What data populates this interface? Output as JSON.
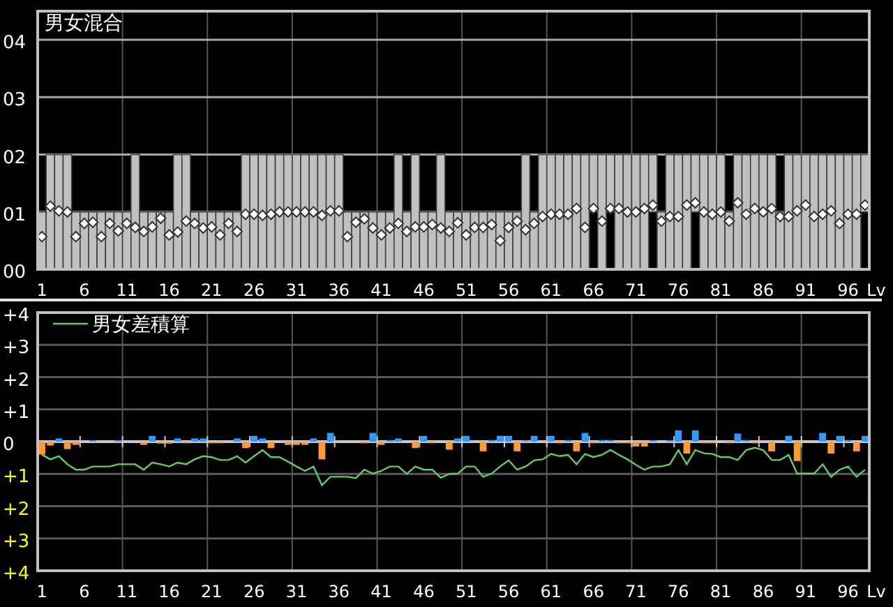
{
  "top_chart": {
    "chart_data": {
      "type": "bar",
      "stacked": true,
      "grid": true,
      "xlabel": "Lv",
      "xlim": [
        0.5,
        98.5
      ],
      "x": [
        1,
        2,
        3,
        4,
        5,
        6,
        7,
        8,
        9,
        10,
        11,
        12,
        13,
        14,
        15,
        16,
        17,
        18,
        19,
        20,
        21,
        22,
        23,
        24,
        25,
        26,
        27,
        28,
        29,
        30,
        31,
        32,
        33,
        34,
        35,
        36,
        37,
        38,
        39,
        40,
        41,
        42,
        43,
        44,
        45,
        46,
        47,
        48,
        49,
        50,
        51,
        52,
        53,
        54,
        55,
        56,
        57,
        58,
        59,
        60,
        61,
        62,
        63,
        64,
        65,
        66,
        67,
        68,
        69,
        70,
        71,
        72,
        73,
        74,
        75,
        76,
        77,
        78,
        79,
        80,
        81,
        82,
        83,
        84,
        85,
        86,
        87,
        88,
        89,
        90,
        91,
        92,
        93,
        94,
        95,
        96,
        97,
        98
      ],
      "xticks": [
        1,
        6,
        11,
        16,
        21,
        26,
        31,
        36,
        41,
        46,
        51,
        56,
        61,
        66,
        71,
        76,
        81,
        86,
        91,
        96
      ],
      "ylim": [
        0,
        4.5
      ],
      "yticks": [
        {
          "value": 0,
          "label": "00"
        },
        {
          "value": 1,
          "label": "01"
        },
        {
          "value": 2,
          "label": "02"
        },
        {
          "value": 3,
          "label": "03"
        },
        {
          "value": 4,
          "label": "04"
        }
      ],
      "series": [
        {
          "color": "#000000",
          "values": [
            0,
            0,
            0,
            0,
            0,
            0,
            0,
            0,
            0,
            0,
            0,
            0,
            0,
            0,
            0,
            0,
            0,
            0,
            0,
            0,
            0,
            0,
            0,
            0,
            0,
            0,
            0,
            0,
            0,
            0,
            0,
            0,
            0,
            0,
            0,
            0,
            0,
            0,
            0,
            0,
            0,
            0,
            0,
            0,
            0,
            0,
            0,
            0,
            0,
            0,
            0,
            0,
            0,
            0,
            0,
            0,
            0,
            0,
            0,
            0,
            0,
            0,
            0,
            0,
            0,
            1,
            0,
            1,
            0,
            0,
            0,
            0,
            1,
            0,
            0,
            0,
            0,
            1,
            0,
            0,
            0,
            0,
            0,
            0,
            0,
            0,
            0,
            0,
            0,
            0,
            0,
            0,
            0,
            0,
            0,
            0,
            0,
            1
          ]
        },
        {
          "color": "#c0c0c0",
          "values": [
            1,
            2,
            2,
            2,
            1,
            1,
            1,
            1,
            1,
            1,
            1,
            2,
            1,
            1,
            1,
            1,
            2,
            2,
            1,
            1,
            1,
            1,
            1,
            1,
            2,
            2,
            2,
            2,
            2,
            2,
            2,
            2,
            2,
            2,
            2,
            2,
            1,
            1,
            1,
            1,
            1,
            1,
            2,
            1,
            2,
            1,
            1,
            2,
            1,
            1,
            1,
            1,
            1,
            1,
            1,
            1,
            1,
            2,
            1,
            2,
            2,
            2,
            2,
            2,
            2,
            1,
            2,
            1,
            2,
            2,
            2,
            2,
            1,
            1,
            2,
            2,
            2,
            1,
            2,
            2,
            2,
            1,
            2,
            2,
            2,
            2,
            2,
            1,
            2,
            2,
            2,
            2,
            2,
            2,
            2,
            2,
            2,
            1
          ]
        },
        {
          "type": "scatter",
          "name": "男女混合",
          "color": "#ffffff",
          "values": [
            0.57,
            1.1,
            1.02,
            1.0,
            0.57,
            0.8,
            0.82,
            0.57,
            0.8,
            0.67,
            0.8,
            0.73,
            0.66,
            0.74,
            0.89,
            0.6,
            0.65,
            0.84,
            0.8,
            0.72,
            0.74,
            0.6,
            0.8,
            0.66,
            0.96,
            0.96,
            0.94,
            0.96,
            1.0,
            1.0,
            1.0,
            1.0,
            1.0,
            0.94,
            1.02,
            1.02,
            0.57,
            0.82,
            0.88,
            0.72,
            0.6,
            0.72,
            0.8,
            0.66,
            0.74,
            0.74,
            0.78,
            0.72,
            0.66,
            0.81,
            0.6,
            0.73,
            0.73,
            0.78,
            0.5,
            0.73,
            0.84,
            0.69,
            0.8,
            0.92,
            0.96,
            0.96,
            0.96,
            1.06,
            0.73,
            1.06,
            0.84,
            1.06,
            1.06,
            1.0,
            1.0,
            1.06,
            1.12,
            0.84,
            0.92,
            0.92,
            1.12,
            1.16,
            1.0,
            0.96,
            1.0,
            0.84,
            1.16,
            0.96,
            1.06,
            1.0,
            1.06,
            0.92,
            0.92,
            1.02,
            1.12,
            0.92,
            0.96,
            1.02,
            0.8,
            0.96,
            0.96,
            1.12
          ]
        }
      ]
    }
  },
  "bottom_chart": {
    "chart_data": {
      "type": "bar",
      "grid": true,
      "xlabel": "Lv",
      "xlim": [
        0.5,
        98.5
      ],
      "x": [
        1,
        2,
        3,
        4,
        5,
        6,
        7,
        8,
        9,
        10,
        11,
        12,
        13,
        14,
        15,
        16,
        17,
        18,
        19,
        20,
        21,
        22,
        23,
        24,
        25,
        26,
        27,
        28,
        29,
        30,
        31,
        32,
        33,
        34,
        35,
        36,
        37,
        38,
        39,
        40,
        41,
        42,
        43,
        44,
        45,
        46,
        47,
        48,
        49,
        50,
        51,
        52,
        53,
        54,
        55,
        56,
        57,
        58,
        59,
        60,
        61,
        62,
        63,
        64,
        65,
        66,
        67,
        68,
        69,
        70,
        71,
        72,
        73,
        74,
        75,
        76,
        77,
        78,
        79,
        80,
        81,
        82,
        83,
        84,
        85,
        86,
        87,
        88,
        89,
        90,
        91,
        92,
        93,
        94,
        95,
        96,
        97,
        98
      ],
      "xticks": [
        1,
        6,
        11,
        16,
        21,
        26,
        31,
        36,
        41,
        46,
        51,
        56,
        61,
        66,
        71,
        76,
        81,
        86,
        91,
        96
      ],
      "ylim": [
        -4,
        4
      ],
      "yticks": [
        {
          "value": 4,
          "label": "+4"
        },
        {
          "value": 3,
          "label": "+3"
        },
        {
          "value": 2,
          "label": "+2"
        },
        {
          "value": 1,
          "label": "+1"
        },
        {
          "value": 0,
          "label": "0"
        },
        {
          "value": -1,
          "label": "+1"
        },
        {
          "value": -2,
          "label": "+2"
        },
        {
          "value": -3,
          "label": "+3"
        },
        {
          "value": -4,
          "label": "+4"
        }
      ],
      "series": [
        {
          "color": "#3399ff",
          "values": [
            0,
            0,
            0.1,
            0,
            0,
            0,
            0.04,
            0,
            0,
            0.04,
            0,
            0,
            0,
            0.18,
            0,
            0,
            0.1,
            0,
            0.1,
            0.1,
            0,
            0,
            0,
            0.1,
            0,
            0.18,
            0.1,
            0,
            0,
            0,
            0,
            0,
            0.1,
            0,
            0.27,
            0,
            0,
            0,
            0,
            0.27,
            0,
            0.05,
            0.1,
            0,
            0,
            0.18,
            0,
            0,
            0,
            0.1,
            0.18,
            0,
            0,
            0.05,
            0.18,
            0.18,
            0,
            0.03,
            0.18,
            0,
            0.18,
            0,
            0.05,
            0,
            0.27,
            0,
            0.05,
            0.05,
            0,
            0,
            0,
            0,
            0.04,
            0,
            0.04,
            0.35,
            0,
            0.35,
            0,
            0,
            0,
            0,
            0.25,
            0.05,
            0,
            0,
            0,
            0,
            0.18,
            0,
            0,
            0,
            0.27,
            0,
            0.18,
            0.05,
            0,
            0.18
          ]
        },
        {
          "color": "#ff9933",
          "values": [
            -0.4,
            -0.12,
            0,
            -0.23,
            -0.1,
            0,
            0,
            0,
            0,
            0,
            0,
            0,
            -0.1,
            0,
            -0.06,
            -0.06,
            0,
            -0.05,
            0,
            0,
            -0.05,
            -0.05,
            0,
            0,
            -0.2,
            0,
            0,
            -0.2,
            0,
            -0.1,
            -0.1,
            -0.1,
            0,
            -0.55,
            0,
            0,
            0,
            0,
            -0.05,
            0,
            -0.1,
            0,
            0,
            0,
            -0.2,
            0,
            -0.05,
            0,
            -0.25,
            0,
            0,
            0,
            -0.3,
            0,
            0,
            0,
            -0.3,
            0,
            0,
            0,
            0,
            -0.05,
            0,
            -0.3,
            0,
            -0.05,
            0,
            0,
            -0.05,
            -0.05,
            -0.15,
            -0.15,
            0,
            0,
            0,
            0,
            -0.37,
            0,
            -0.05,
            -0.05,
            0,
            -0.05,
            0,
            0,
            -0.05,
            0,
            -0.3,
            0,
            0,
            -0.6,
            0,
            0,
            0,
            -0.37,
            0,
            0,
            -0.3,
            0
          ]
        },
        {
          "type": "line",
          "name": "男女差積算",
          "color": "#66cc66",
          "values": [
            -0.4,
            -0.55,
            -0.45,
            -0.7,
            -0.87,
            -0.87,
            -0.77,
            -0.77,
            -0.77,
            -0.7,
            -0.7,
            -0.7,
            -0.87,
            -0.65,
            -0.7,
            -0.77,
            -0.65,
            -0.7,
            -0.55,
            -0.45,
            -0.48,
            -0.57,
            -0.57,
            -0.45,
            -0.65,
            -0.45,
            -0.26,
            -0.48,
            -0.48,
            -0.62,
            -0.77,
            -0.91,
            -0.77,
            -1.35,
            -1.09,
            -1.09,
            -1.09,
            -1.13,
            -0.87,
            -0.99,
            -0.91,
            -0.77,
            -0.77,
            -1.0,
            -0.77,
            -0.87,
            -0.87,
            -1.12,
            -1.0,
            -0.99,
            -0.77,
            -0.77,
            -1.09,
            -0.99,
            -0.77,
            -0.58,
            -0.87,
            -0.77,
            -0.58,
            -0.55,
            -0.38,
            -0.45,
            -0.41,
            -0.7,
            -0.38,
            -0.48,
            -0.41,
            -0.26,
            -0.41,
            -0.55,
            -0.72,
            -0.87,
            -0.77,
            -0.77,
            -0.7,
            -0.26,
            -0.7,
            -0.26,
            -0.36,
            -0.38,
            -0.48,
            -0.48,
            -0.57,
            -0.26,
            -0.19,
            -0.26,
            -0.57,
            -0.57,
            -0.41,
            -0.99,
            -0.99,
            -0.99,
            -0.7,
            -1.09,
            -0.87,
            -0.77,
            -1.09,
            -0.87
          ]
        }
      ]
    }
  }
}
